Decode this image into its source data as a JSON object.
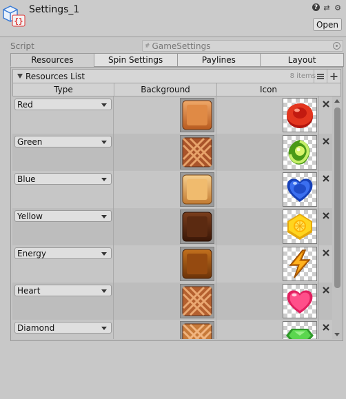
{
  "header": {
    "title": "Settings_1",
    "open_label": "Open"
  },
  "script": {
    "label": "Script",
    "value": "GameSettings"
  },
  "tabs": [
    {
      "label": "Resources",
      "active": true
    },
    {
      "label": "Spin Settings",
      "active": false
    },
    {
      "label": "Paylines",
      "active": false
    },
    {
      "label": "Layout",
      "active": false
    }
  ],
  "resources_list": {
    "title": "Resources List",
    "count": "8 items",
    "columns": {
      "type": "Type",
      "background": "Background",
      "icon": "Icon"
    },
    "rows": [
      {
        "type": "Red",
        "background": "orange-tile",
        "icon": "red-button-candy"
      },
      {
        "type": "Green",
        "background": "waffle-tile",
        "icon": "green-striped-candy"
      },
      {
        "type": "Blue",
        "background": "light-orange-tile",
        "icon": "blue-heart-candy"
      },
      {
        "type": "Yellow",
        "background": "dark-brown-tile",
        "icon": "yellow-lemon-candy"
      },
      {
        "type": "Energy",
        "background": "brown-tile",
        "icon": "lightning-bolt"
      },
      {
        "type": "Heart",
        "background": "waffle-tile",
        "icon": "pink-heart"
      },
      {
        "type": "Diamond",
        "background": "waffle-tile",
        "icon": "green-gem"
      }
    ]
  }
}
